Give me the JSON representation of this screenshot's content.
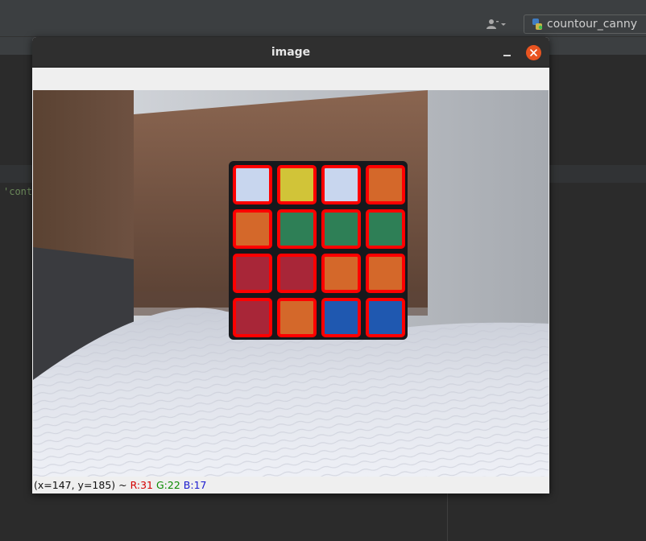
{
  "ide": {
    "code_snippet": "'cont",
    "run_config": {
      "label": "countour_canny"
    }
  },
  "window": {
    "title": "image",
    "status": {
      "coords": "(x=147, y=185) ~ ",
      "r": "R:31",
      "g": "G:22",
      "b": "B:17"
    }
  },
  "cube": {
    "rows": 4,
    "cols": 4,
    "facelets": [
      [
        "white",
        "yellow",
        "white",
        "orange"
      ],
      [
        "orange",
        "green",
        "green",
        "green"
      ],
      [
        "red",
        "red",
        "orange",
        "orange"
      ],
      [
        "red",
        "orange",
        "blue",
        "blue"
      ]
    ],
    "colors": {
      "white": "#c8d6ee",
      "yellow": "#d1c438",
      "orange": "#d4682a",
      "green": "#2e7f56",
      "red": "#a82638",
      "blue": "#1f58b0",
      "outline": "#ff0000"
    }
  },
  "colors": {
    "ide_bg": "#2b2b2b",
    "window_titlebar": "#2f2f2f",
    "close_button": "#e95420"
  }
}
